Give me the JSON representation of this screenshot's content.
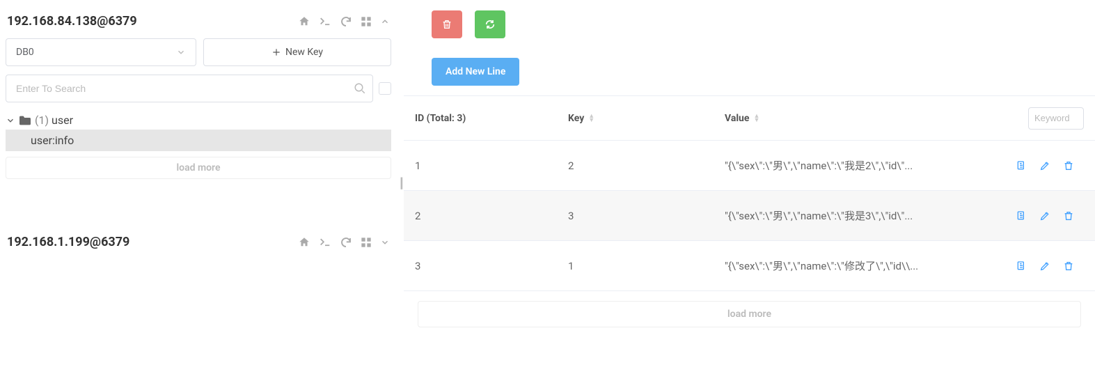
{
  "sidebar": {
    "connections": [
      {
        "title": "192.168.84.138@6379",
        "expanded": true,
        "db_label": "DB0",
        "new_key_label": "New Key",
        "search_placeholder": "Enter To Search",
        "load_more": "load more",
        "tree": {
          "folder_count": "(1)",
          "folder_name": "user",
          "key": "user:info"
        }
      },
      {
        "title": "192.168.1.199@6379",
        "expanded": false
      }
    ]
  },
  "main": {
    "add_new_line": "Add New Line",
    "table": {
      "id_header": "ID (Total: 3)",
      "key_header": "Key",
      "value_header": "Value",
      "keyword_placeholder": "Keyword",
      "rows": [
        {
          "id": "1",
          "key": "2",
          "value": "\"{\\\"sex\\\":\\\"男\\\",\\\"name\\\":\\\"我是2\\\",\\\"id\\\"..."
        },
        {
          "id": "2",
          "key": "3",
          "value": "\"{\\\"sex\\\":\\\"男\\\",\\\"name\\\":\\\"我是3\\\",\\\"id\\\"..."
        },
        {
          "id": "3",
          "key": "1",
          "value": "\"{\\\"sex\\\":\\\"男\\\",\\\"name\\\":\\\"修改了\\\",\\\"id\\\\..."
        }
      ],
      "load_more": "load more"
    }
  }
}
